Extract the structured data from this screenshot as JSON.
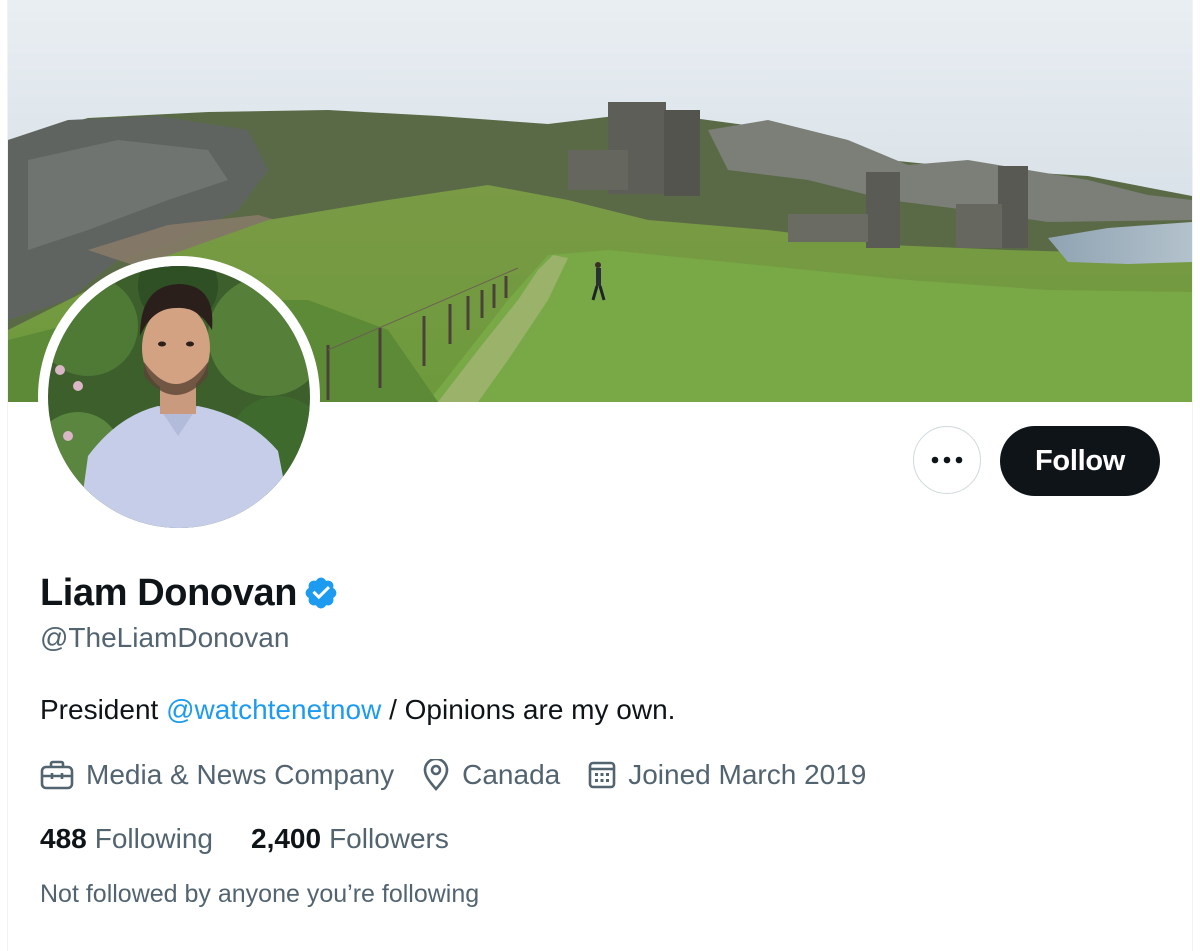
{
  "profile": {
    "display_name": "Liam Donovan",
    "handle": "@TheLiamDonovan",
    "verified": true,
    "bio_prefix": "President ",
    "bio_mention": "@watchtenetnow",
    "bio_suffix": " / Opinions are my own.",
    "category": "Media & News Company",
    "location": "Canada",
    "joined": "Joined March 2019",
    "following_count": "488",
    "following_label": "Following",
    "followers_count": "2,400",
    "followers_label": "Followers",
    "followed_by": "Not followed by anyone you’re following"
  },
  "actions": {
    "follow_label": "Follow",
    "more_icon": "more-horizontal-icon"
  },
  "icons": {
    "category": "briefcase-icon",
    "location": "location-pin-icon",
    "joined": "calendar-icon",
    "verified": "verified-badge-icon"
  },
  "colors": {
    "text_primary": "#0f1419",
    "text_secondary": "#536471",
    "accent": "#1d9bf0",
    "follow_button": "#0f1419"
  }
}
